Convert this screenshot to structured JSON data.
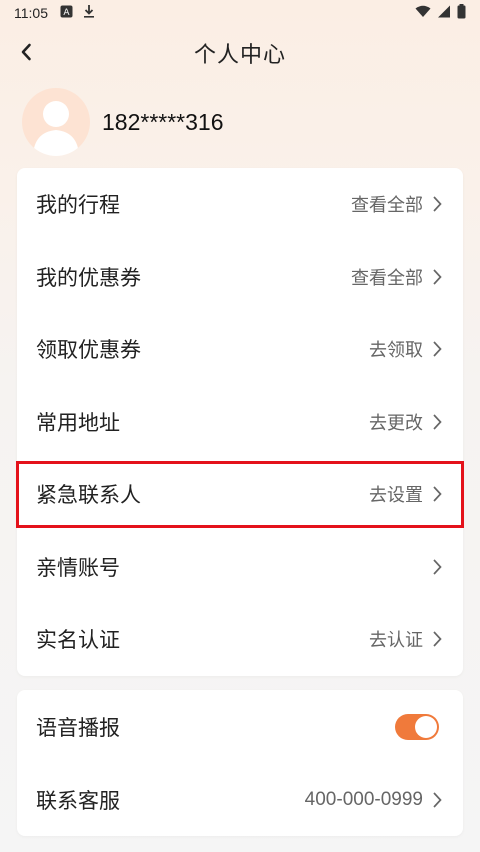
{
  "status_bar": {
    "time": "11:05",
    "icons_left": [
      "a-badge-icon",
      "download-icon"
    ],
    "icons_right": [
      "wifi-icon",
      "signal-icon",
      "battery-icon"
    ]
  },
  "header": {
    "title": "个人中心",
    "back_icon": "chevron-left-icon"
  },
  "profile": {
    "phone": "182*****316",
    "avatar_icon": "person-icon"
  },
  "menu": {
    "items": [
      {
        "label": "我的行程",
        "value": "查看全部"
      },
      {
        "label": "我的优惠券",
        "value": "查看全部"
      },
      {
        "label": "领取优惠券",
        "value": "去领取"
      },
      {
        "label": "常用地址",
        "value": "去更改"
      },
      {
        "label": "紧急联系人",
        "value": "去设置",
        "highlighted": true
      },
      {
        "label": "亲情账号",
        "value": ""
      },
      {
        "label": "实名认证",
        "value": "去认证"
      }
    ]
  },
  "settings": {
    "voice": {
      "label": "语音播报",
      "enabled": true
    },
    "service": {
      "label": "联系客服",
      "value": "400-000-0999"
    }
  },
  "colors": {
    "accent": "#f07a3b",
    "highlight_border": "#e4121b",
    "avatar_bg": "#fde3d3"
  }
}
